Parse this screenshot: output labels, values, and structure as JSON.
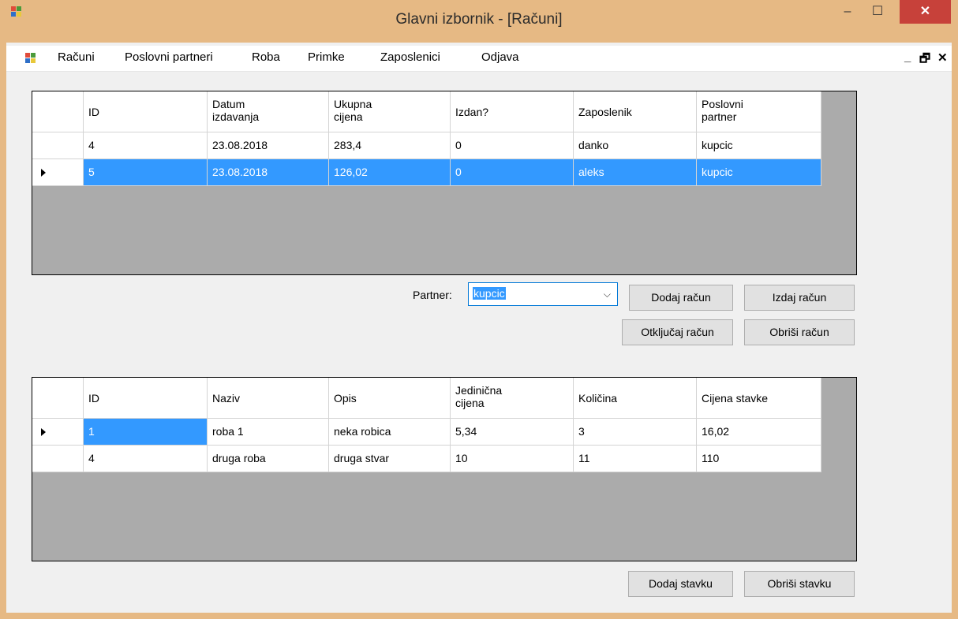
{
  "window": {
    "title": "Glavni izbornik - [Računi]",
    "minimize": "–",
    "maximize": "☐",
    "close": "✕"
  },
  "menu": {
    "items": [
      "Računi",
      "Poslovni partneri",
      "Roba",
      "Primke",
      "Zaposlenici",
      "Odjava"
    ],
    "mdi_minimize": "_",
    "mdi_restore": "🗗",
    "mdi_close": "✕"
  },
  "invoices": {
    "columns": [
      [
        "ID"
      ],
      [
        "Datum",
        "izdavanja"
      ],
      [
        "Ukupna",
        "cijena"
      ],
      [
        "Izdan?"
      ],
      [
        "Zaposlenik"
      ],
      [
        "Poslovni",
        "partner"
      ]
    ],
    "rows": [
      [
        "4",
        "23.08.2018",
        "283,4",
        "0",
        "danko",
        "kupcic"
      ],
      [
        "5",
        "23.08.2018",
        "126,02",
        "0",
        "aleks",
        "kupcic"
      ]
    ],
    "selected_row": 1
  },
  "controls": {
    "partner_label": "Partner:",
    "partner_value": "kupcic",
    "add_invoice": "Dodaj račun",
    "issue_invoice": "Izdaj račun",
    "unlock_invoice": "Otključaj račun",
    "delete_invoice": "Obriši račun"
  },
  "items": {
    "columns": [
      [
        "ID"
      ],
      [
        "Naziv"
      ],
      [
        "Opis"
      ],
      [
        "Jedinična",
        "cijena"
      ],
      [
        "Količina"
      ],
      [
        "Cijena stavke"
      ]
    ],
    "rows": [
      [
        "1",
        "roba 1",
        "neka robica",
        "5,34",
        "3",
        "16,02"
      ],
      [
        "4",
        "druga roba",
        "druga stvar",
        "10",
        "11",
        "110"
      ]
    ],
    "selected_cell": [
      0,
      0
    ],
    "current_row": 0
  },
  "item_controls": {
    "add_item": "Dodaj stavku",
    "delete_item": "Obriši stavku"
  },
  "colors": {
    "title_bar": "#e6b984",
    "close_button": "#c7413a",
    "selection": "#3399ff",
    "grid_background": "#ababab"
  }
}
